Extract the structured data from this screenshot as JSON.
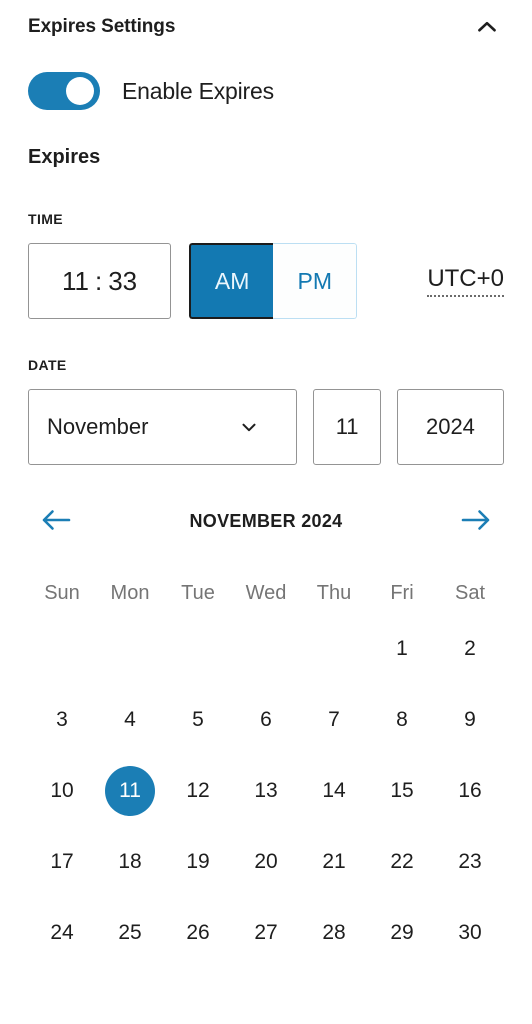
{
  "header": {
    "title": "Expires Settings",
    "collapse_icon": "chevron-up-icon"
  },
  "enable_toggle": {
    "label": "Enable Expires",
    "state": "on",
    "color": "#1b7eb5"
  },
  "section": {
    "heading": "Expires"
  },
  "time": {
    "label": "TIME",
    "hour": "11",
    "separator": ":",
    "minute": "33",
    "meridiem_selected": "AM",
    "am_label": "AM",
    "pm_label": "PM",
    "timezone": "UTC+0"
  },
  "date": {
    "label": "DATE",
    "month": "November",
    "month_caret_icon": "chevron-down-icon",
    "day": "11",
    "year": "2024"
  },
  "calendar": {
    "prev_icon": "arrow-left-icon",
    "next_icon": "arrow-right-icon",
    "month_title": "NOVEMBER",
    "year_title": "2024",
    "weekdays": [
      "Sun",
      "Mon",
      "Tue",
      "Wed",
      "Thu",
      "Fri",
      "Sat"
    ],
    "selected_day": 11,
    "accent_color": "#1b7eb5",
    "weeks": [
      [
        "",
        "",
        "",
        "",
        "",
        "1",
        "2"
      ],
      [
        "3",
        "4",
        "5",
        "6",
        "7",
        "8",
        "9"
      ],
      [
        "10",
        "11",
        "12",
        "13",
        "14",
        "15",
        "16"
      ],
      [
        "17",
        "18",
        "19",
        "20",
        "21",
        "22",
        "23"
      ],
      [
        "24",
        "25",
        "26",
        "27",
        "28",
        "29",
        "30"
      ]
    ]
  }
}
